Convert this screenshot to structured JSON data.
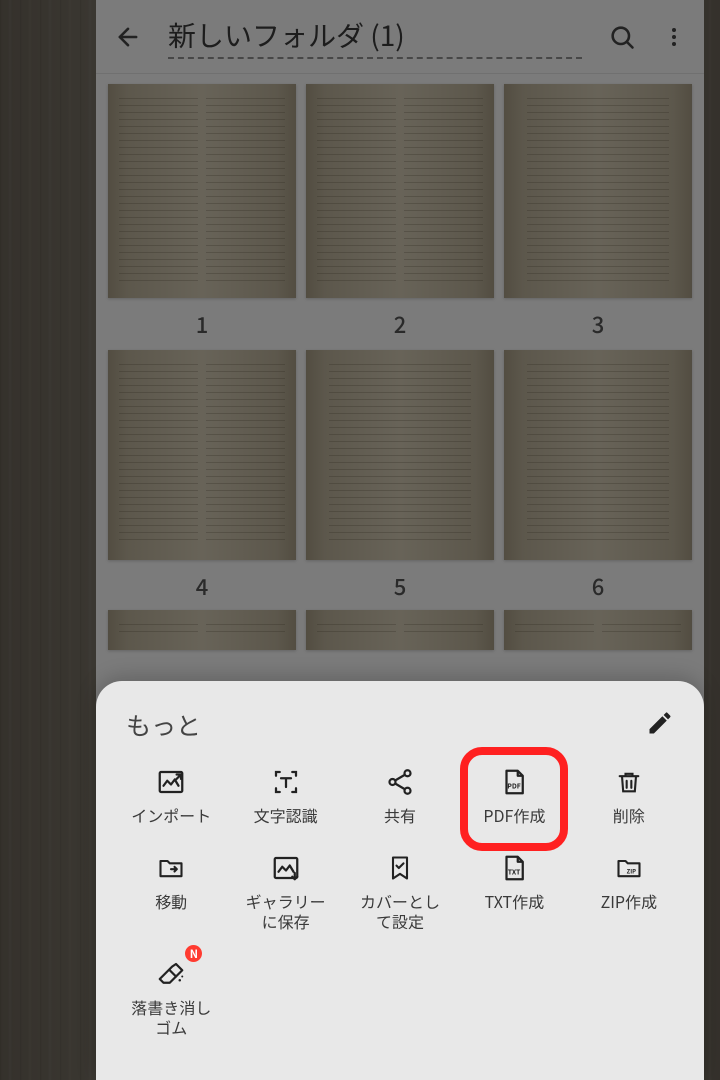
{
  "header": {
    "title": "新しいフォルダ (1)"
  },
  "thumbnails": {
    "labels": [
      "1",
      "2",
      "3",
      "4",
      "5",
      "6"
    ]
  },
  "sheet": {
    "title": "もっと",
    "items": [
      {
        "label": "インポート"
      },
      {
        "label": "文字認識"
      },
      {
        "label": "共有"
      },
      {
        "label": "PDF作成"
      },
      {
        "label": "削除"
      },
      {
        "label": "移動"
      },
      {
        "label": "ギャラリー\nに保存"
      },
      {
        "label": "カバーとし\nて設定"
      },
      {
        "label": "TXT作成"
      },
      {
        "label": "ZIP作成"
      },
      {
        "label": "落書き消し\nゴム"
      }
    ],
    "badge": "N"
  }
}
